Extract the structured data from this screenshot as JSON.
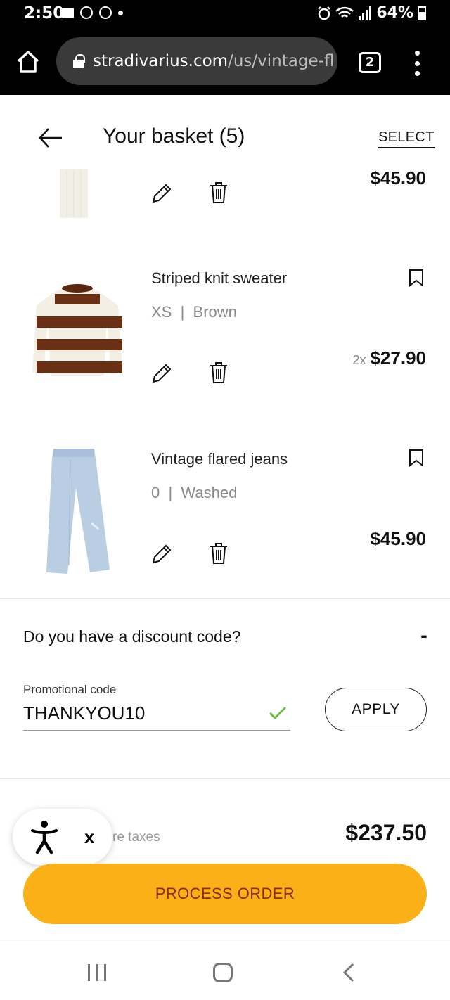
{
  "status_bar": {
    "time": "2:50",
    "battery": "64%"
  },
  "browser": {
    "url_host": "stradivarius.com",
    "url_path": "/us/vintage-fl",
    "tab_count": "2"
  },
  "header": {
    "title": "Your basket (5)",
    "select_label": "SELECT"
  },
  "items": [
    {
      "name": "",
      "attrs": "",
      "price": "$45.90",
      "qty": ""
    },
    {
      "name": "Striped knit sweater",
      "size": "XS",
      "color": "Brown",
      "price": "$27.90",
      "qty": "2x"
    },
    {
      "name": "Vintage flared jeans",
      "size": "0",
      "color": "Washed",
      "price": "$45.90",
      "qty": ""
    }
  ],
  "discount": {
    "question": "Do you have a discount code?",
    "toggle": "-",
    "promo_label": "Promotional code",
    "promo_value": "THANKYOU10",
    "apply_label": "APPLY"
  },
  "total": {
    "taxes_label": "re taxes",
    "value": "$237.50"
  },
  "accessibility": {
    "close_label": "x"
  },
  "process_label": "PROCESS ORDER",
  "colors": {
    "process_button": "#fbb017",
    "process_text": "#8a2b14",
    "check": "#6cc04a"
  }
}
